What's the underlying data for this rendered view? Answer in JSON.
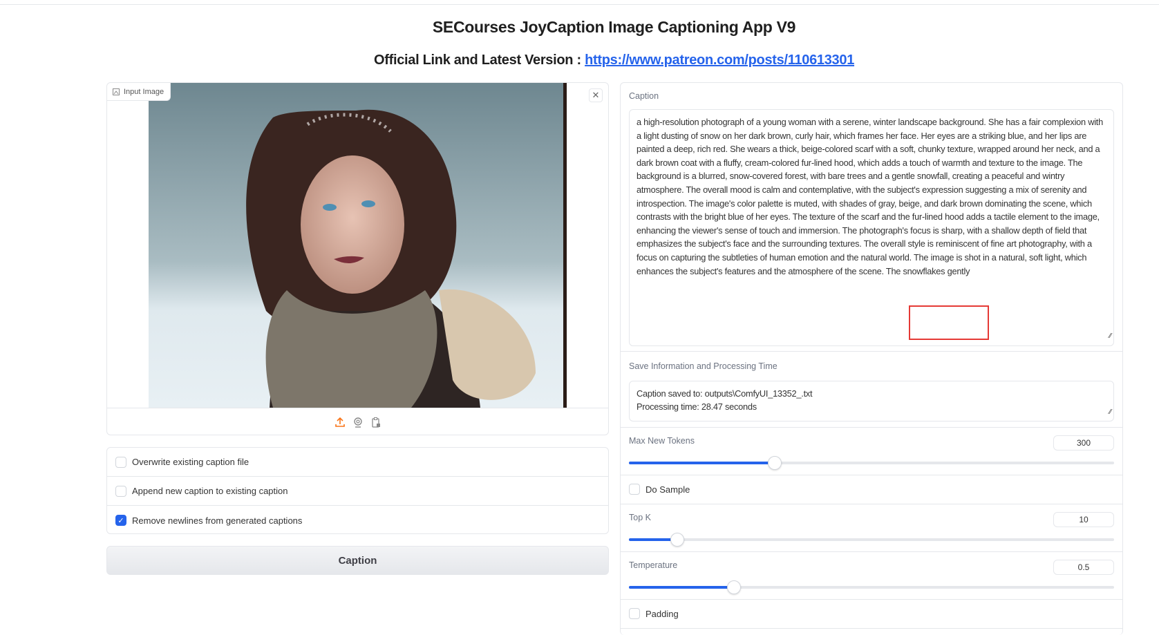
{
  "header": {
    "title": "SECourses JoyCaption Image Captioning App V9",
    "link_prefix": "Official Link and Latest Version : ",
    "link_url": "https://www.patreon.com/posts/110613301"
  },
  "input_image": {
    "label": "Input Image",
    "icons": [
      "upload-icon",
      "webcam-icon",
      "clipboard-icon"
    ],
    "accent": "#f97316"
  },
  "options": [
    {
      "label": "Overwrite existing caption file",
      "checked": false
    },
    {
      "label": "Append new caption to existing caption",
      "checked": false
    },
    {
      "label": "Remove newlines from generated captions",
      "checked": true
    }
  ],
  "caption_button": "Caption",
  "caption": {
    "label": "Caption",
    "text": "a high-resolution photograph of a young woman with a serene, winter landscape background. She has a fair complexion with a light dusting of snow on her dark brown, curly hair, which frames her face. Her eyes are a striking blue, and her lips are painted a deep, rich red. She wears a thick, beige-colored scarf with a soft, chunky texture, wrapped around her neck, and a dark brown coat with a fluffy, cream-colored fur-lined hood, which adds a touch of warmth and texture to the image. The background is a blurred, snow-covered forest, with bare trees and a gentle snowfall, creating a peaceful and wintry atmosphere. The overall mood is calm and contemplative, with the subject's expression suggesting a mix of serenity and introspection. The image's color palette is muted, with shades of gray, beige, and dark brown dominating the scene, which contrasts with the bright blue of her eyes. The texture of the scarf and the fur-lined hood adds a tactile element to the image, enhancing the viewer's sense of touch and immersion. The photograph's focus is sharp, with a shallow depth of field that emphasizes the subject's face and the surrounding textures. The overall style is reminiscent of fine art photography, with a focus on capturing the subtleties of human emotion and the natural world. The image is shot in a natural, soft light, which enhances the subject's features and the atmosphere of the scene. The snowflakes gently"
  },
  "save_info": {
    "label": "Save Information and Processing Time",
    "line1": "Caption saved to: outputs\\ComfyUI_13352_.txt",
    "line2": "Processing time: 28.47 seconds"
  },
  "sliders": {
    "max_new_tokens": {
      "label": "Max New Tokens",
      "value": "300",
      "fill": 0.3
    },
    "top_k": {
      "label": "Top K",
      "value": "10",
      "fill": 0.1
    },
    "temperature": {
      "label": "Temperature",
      "value": "0.5",
      "fill": 0.216
    }
  },
  "do_sample": {
    "label": "Do Sample",
    "checked": false
  },
  "padding": {
    "label": "Padding",
    "checked": false
  },
  "colors": {
    "accent": "#2563eb",
    "annotation": "#e53935"
  }
}
